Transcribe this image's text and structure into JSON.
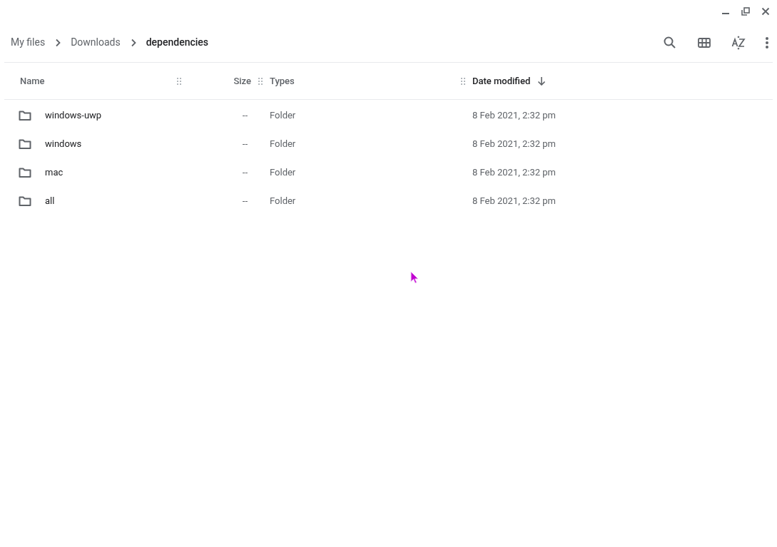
{
  "breadcrumbs": [
    {
      "label": "My files",
      "selected": false
    },
    {
      "label": "Downloads",
      "selected": false
    },
    {
      "label": "dependencies",
      "selected": true
    }
  ],
  "columns": [
    {
      "label": "Name",
      "sorted": false
    },
    {
      "label": "Size",
      "sorted": false
    },
    {
      "label": "Types",
      "sorted": false
    },
    {
      "label": "Date modified",
      "sorted": true
    }
  ],
  "rows": [
    {
      "name": "windows-uwp",
      "size": "--",
      "type": "Folder",
      "date": "8 Feb 2021, 2:32 pm"
    },
    {
      "name": "windows",
      "size": "--",
      "type": "Folder",
      "date": "8 Feb 2021, 2:32 pm"
    },
    {
      "name": "mac",
      "size": "--",
      "type": "Folder",
      "date": "8 Feb 2021, 2:32 pm"
    },
    {
      "name": "all",
      "size": "--",
      "type": "Folder",
      "date": "8 Feb 2021, 2:32 pm"
    }
  ]
}
